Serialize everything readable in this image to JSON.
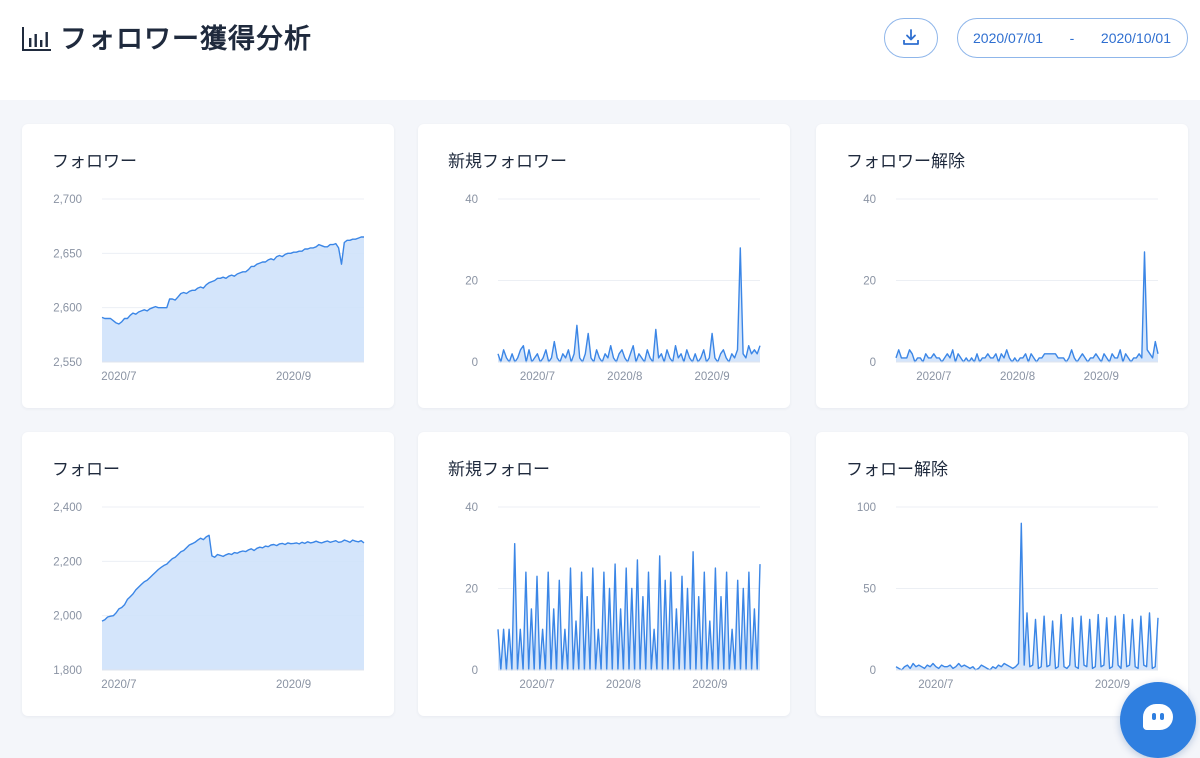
{
  "header": {
    "title": "フォロワー獲得分析",
    "title_icon": "bar-chart-icon",
    "download_icon": "download-icon",
    "date_from": "2020/07/01",
    "date_sep": "-",
    "date_to": "2020/10/01"
  },
  "colors": {
    "accent": "#2f7fe0",
    "line": "#3b86e6",
    "fill": "#cfe2fb",
    "grid": "#eceff4",
    "button_border": "#8fb6ea"
  },
  "chat_icon": "chat-bubble-icon",
  "chart_data": [
    {
      "id": "followers",
      "title": "フォロワー",
      "type": "area",
      "ylim": [
        2550,
        2700
      ],
      "yticks": [
        "2,550",
        "2,600",
        "2,650",
        "2,700"
      ],
      "xticks": [
        {
          "label": "2020/7",
          "index": 6
        },
        {
          "label": "2020/9",
          "index": 68
        }
      ],
      "values": [
        2591,
        2590,
        2590,
        2590,
        2588,
        2586,
        2585,
        2587,
        2590,
        2590,
        2593,
        2595,
        2594,
        2596,
        2597,
        2598,
        2597,
        2599,
        2600,
        2601,
        2600,
        2600,
        2600,
        2600,
        2608,
        2608,
        2607,
        2610,
        2613,
        2614,
        2613,
        2615,
        2616,
        2616,
        2618,
        2619,
        2618,
        2621,
        2623,
        2624,
        2625,
        2627,
        2627,
        2628,
        2627,
        2629,
        2630,
        2629,
        2631,
        2632,
        2633,
        2633,
        2635,
        2638,
        2638,
        2640,
        2641,
        2642,
        2642,
        2644,
        2645,
        2644,
        2647,
        2648,
        2647,
        2649,
        2650,
        2650,
        2651,
        2651,
        2652,
        2652,
        2654,
        2654,
        2655,
        2655,
        2656,
        2658,
        2657,
        2656,
        2656,
        2658,
        2658,
        2659,
        2655,
        2640,
        2660,
        2662,
        2662,
        2663,
        2663,
        2664,
        2665,
        2665
      ]
    },
    {
      "id": "new-followers",
      "title": "新規フォロワー",
      "type": "area",
      "ylim": [
        0,
        40
      ],
      "yticks": [
        "0",
        "20",
        "40"
      ],
      "xticks": [
        {
          "label": "2020/7",
          "index": 14
        },
        {
          "label": "2020/8",
          "index": 45
        },
        {
          "label": "2020/9",
          "index": 76
        }
      ],
      "values": [
        2,
        0,
        3,
        1,
        0,
        2,
        0,
        1,
        3,
        4,
        0,
        3,
        0,
        1,
        2,
        0,
        1,
        3,
        0,
        1,
        5,
        1,
        0,
        2,
        1,
        3,
        0,
        2,
        9,
        1,
        0,
        2,
        7,
        1,
        0,
        3,
        1,
        0,
        2,
        1,
        4,
        1,
        0,
        2,
        3,
        1,
        0,
        2,
        4,
        0,
        2,
        1,
        0,
        3,
        1,
        0,
        8,
        1,
        2,
        0,
        3,
        1,
        0,
        4,
        1,
        2,
        0,
        3,
        1,
        0,
        2,
        0,
        1,
        3,
        0,
        1,
        7,
        1,
        0,
        2,
        3,
        1,
        0,
        2,
        1,
        3,
        28,
        2,
        1,
        4,
        2,
        3,
        2,
        4
      ]
    },
    {
      "id": "follower-removals",
      "title": "フォロワー解除",
      "type": "area",
      "ylim": [
        0,
        40
      ],
      "yticks": [
        "0",
        "20",
        "40"
      ],
      "xticks": [
        {
          "label": "2020/7",
          "index": 14
        },
        {
          "label": "2020/8",
          "index": 45
        },
        {
          "label": "2020/9",
          "index": 76
        }
      ],
      "values": [
        1,
        3,
        1,
        1,
        1,
        3,
        2,
        0,
        1,
        1,
        0,
        2,
        1,
        1,
        2,
        1,
        1,
        0,
        1,
        2,
        1,
        3,
        0,
        2,
        1,
        0,
        1,
        0,
        1,
        0,
        2,
        0,
        1,
        1,
        2,
        1,
        1,
        2,
        0,
        2,
        1,
        3,
        1,
        0,
        1,
        0,
        1,
        1,
        2,
        0,
        2,
        1,
        0,
        1,
        1,
        2,
        2,
        2,
        2,
        2,
        1,
        1,
        1,
        0,
        1,
        3,
        1,
        0,
        1,
        2,
        1,
        0,
        1,
        1,
        2,
        1,
        0,
        2,
        1,
        0,
        2,
        1,
        1,
        3,
        0,
        2,
        1,
        0,
        1,
        1,
        2,
        1,
        27,
        3,
        2,
        1,
        5,
        2
      ]
    },
    {
      "id": "following",
      "title": "フォロー",
      "type": "area",
      "ylim": [
        1800,
        2400
      ],
      "yticks": [
        "1,800",
        "2,000",
        "2,200",
        "2,400"
      ],
      "xticks": [
        {
          "label": "2020/7",
          "index": 6
        },
        {
          "label": "2020/9",
          "index": 68
        }
      ],
      "values": [
        1980,
        1985,
        1995,
        1998,
        2000,
        2010,
        2025,
        2030,
        2040,
        2060,
        2070,
        2080,
        2095,
        2105,
        2115,
        2125,
        2130,
        2140,
        2150,
        2160,
        2170,
        2178,
        2185,
        2190,
        2200,
        2210,
        2215,
        2225,
        2235,
        2240,
        2250,
        2260,
        2265,
        2270,
        2278,
        2285,
        2280,
        2290,
        2296,
        2220,
        2215,
        2225,
        2222,
        2218,
        2224,
        2228,
        2225,
        2232,
        2230,
        2235,
        2238,
        2236,
        2242,
        2246,
        2240,
        2248,
        2252,
        2250,
        2256,
        2254,
        2260,
        2262,
        2258,
        2264,
        2266,
        2262,
        2268,
        2265,
        2266,
        2268,
        2264,
        2270,
        2266,
        2272,
        2268,
        2270,
        2274,
        2270,
        2268,
        2272,
        2275,
        2270,
        2273,
        2276,
        2270,
        2272,
        2278,
        2275,
        2270,
        2278,
        2274,
        2272,
        2276,
        2268
      ]
    },
    {
      "id": "new-following",
      "title": "新規フォロー",
      "type": "area",
      "ylim": [
        0,
        40
      ],
      "yticks": [
        "0",
        "20",
        "40"
      ],
      "xticks": [
        {
          "label": "2020/7",
          "index": 14
        },
        {
          "label": "2020/8",
          "index": 45
        },
        {
          "label": "2020/9",
          "index": 76
        }
      ],
      "values": [
        10,
        0,
        10,
        0,
        10,
        0,
        31,
        0,
        10,
        0,
        24,
        0,
        15,
        0,
        23,
        0,
        10,
        0,
        24,
        0,
        15,
        0,
        22,
        0,
        10,
        0,
        25,
        0,
        12,
        0,
        24,
        0,
        18,
        0,
        25,
        0,
        10,
        0,
        24,
        0,
        20,
        0,
        26,
        0,
        15,
        0,
        25,
        0,
        20,
        0,
        27,
        0,
        18,
        0,
        24,
        0,
        10,
        0,
        28,
        0,
        22,
        0,
        24,
        0,
        15,
        0,
        23,
        0,
        20,
        0,
        29,
        0,
        18,
        0,
        24,
        0,
        12,
        0,
        25,
        0,
        18,
        0,
        24,
        0,
        10,
        0,
        22,
        0,
        20,
        0,
        24,
        0,
        15,
        0,
        26
      ]
    },
    {
      "id": "following-removals",
      "title": "フォロー解除",
      "type": "area",
      "ylim": [
        0,
        100
      ],
      "yticks": [
        "0",
        "50",
        "100"
      ],
      "xticks": [
        {
          "label": "2020/7",
          "index": 14
        },
        {
          "label": "2020/9",
          "index": 76
        }
      ],
      "values": [
        2,
        1,
        0,
        2,
        3,
        1,
        4,
        2,
        3,
        2,
        1,
        3,
        2,
        4,
        2,
        1,
        3,
        2,
        2,
        3,
        1,
        2,
        4,
        2,
        3,
        2,
        1,
        2,
        0,
        1,
        3,
        2,
        1,
        0,
        2,
        1,
        3,
        2,
        4,
        3,
        2,
        1,
        2,
        4,
        90,
        3,
        35,
        2,
        3,
        31,
        1,
        2,
        33,
        2,
        3,
        30,
        1,
        2,
        34,
        2,
        1,
        3,
        32,
        2,
        1,
        33,
        3,
        2,
        31,
        1,
        2,
        34,
        2,
        3,
        32,
        1,
        2,
        33,
        3,
        1,
        34,
        2,
        3,
        31,
        2,
        1,
        33,
        3,
        2,
        35,
        1,
        2,
        32
      ]
    }
  ]
}
